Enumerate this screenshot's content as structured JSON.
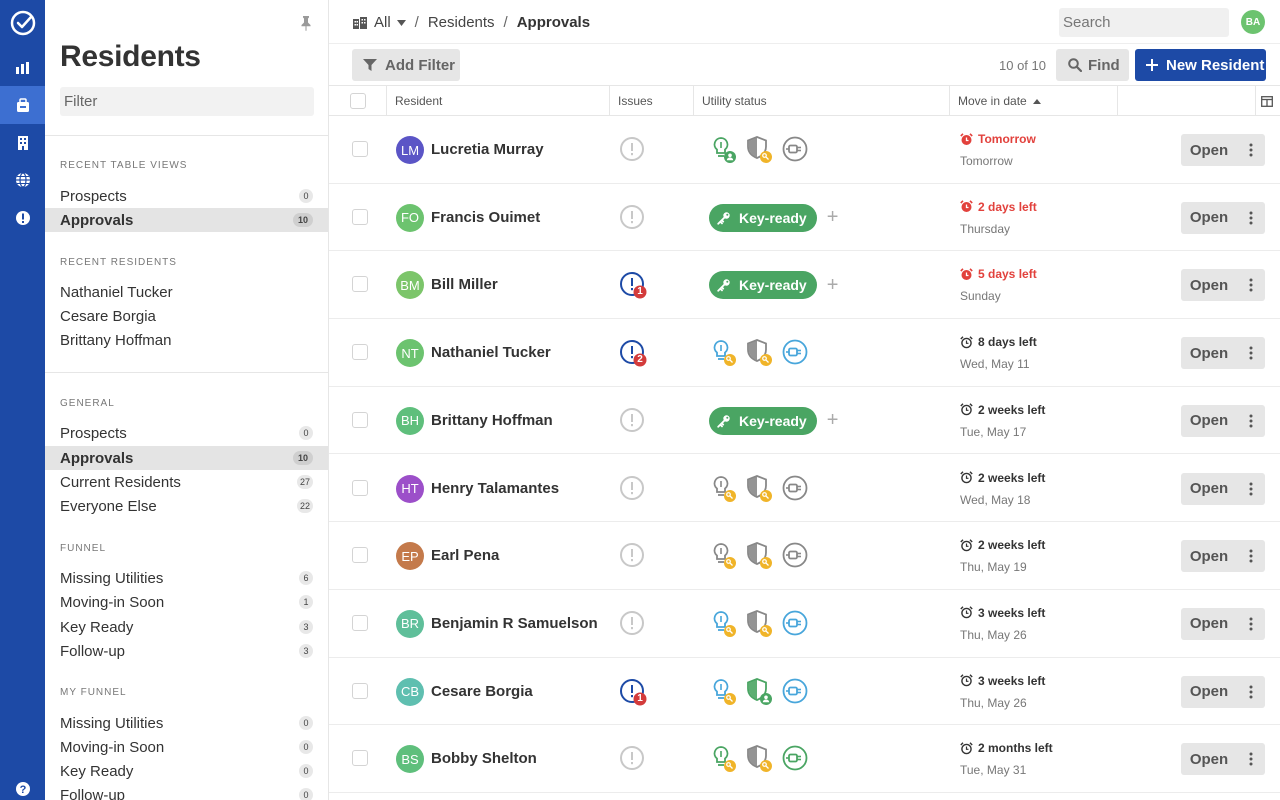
{
  "sidebar": {
    "title": "Residents",
    "filter_placeholder": "Filter",
    "recent_table_views": {
      "heading": "RECENT TABLE VIEWS",
      "items": [
        {
          "label": "Prospects",
          "count": "0"
        },
        {
          "label": "Approvals",
          "count": "10",
          "active": true
        }
      ]
    },
    "recent_residents": {
      "heading": "RECENT RESIDENTS",
      "items": [
        "Nathaniel Tucker",
        "Cesare Borgia",
        "Brittany Hoffman"
      ]
    },
    "general": {
      "heading": "GENERAL",
      "items": [
        {
          "label": "Prospects",
          "count": "0"
        },
        {
          "label": "Approvals",
          "count": "10",
          "active": true
        },
        {
          "label": "Current Residents",
          "count": "27"
        },
        {
          "label": "Everyone Else",
          "count": "22"
        }
      ]
    },
    "funnel": {
      "heading": "FUNNEL",
      "items": [
        {
          "label": "Missing Utilities",
          "count": "6"
        },
        {
          "label": "Moving-in Soon",
          "count": "1"
        },
        {
          "label": "Key Ready",
          "count": "3"
        },
        {
          "label": "Follow-up",
          "count": "3"
        }
      ]
    },
    "my_funnel": {
      "heading": "MY FUNNEL",
      "items": [
        {
          "label": "Missing Utilities",
          "count": "0"
        },
        {
          "label": "Moving-in Soon",
          "count": "0"
        },
        {
          "label": "Key Ready",
          "count": "0"
        },
        {
          "label": "Follow-up",
          "count": "0"
        }
      ]
    }
  },
  "breadcrumb": {
    "all": "All",
    "residents": "Residents",
    "current": "Approvals",
    "sep": "/"
  },
  "search": {
    "placeholder": "Search"
  },
  "user": {
    "initials": "BA",
    "color": "#6cc36f"
  },
  "toolbar": {
    "add_filter": "Add Filter",
    "count_label": "10 of 10",
    "find": "Find",
    "new_resident": "New Resident"
  },
  "table": {
    "columns": {
      "resident": "Resident",
      "issues": "Issues",
      "utility_status": "Utility status",
      "move_in_date": "Move in date"
    },
    "open_label": "Open",
    "key_ready_label": "Key-ready",
    "rows": [
      {
        "initials": "LM",
        "name": "Lucretia Murray",
        "avatar_color": "#5b55c6",
        "issues": 0,
        "utility": [
          "power-green-person",
          "shield-gray-key",
          "plug-gray"
        ],
        "urgent": true,
        "move_primary": "Tomorrow",
        "move_secondary": "Tomorrow"
      },
      {
        "initials": "FO",
        "name": "Francis Ouimet",
        "avatar_color": "#6cc36f",
        "issues": 0,
        "utility": "key-ready",
        "urgent": true,
        "move_primary": "2 days left",
        "move_secondary": "Thursday"
      },
      {
        "initials": "BM",
        "name": "Bill Miller",
        "avatar_color": "#7cc56a",
        "issues": 1,
        "utility": "key-ready",
        "urgent": true,
        "move_primary": "5 days left",
        "move_secondary": "Sunday"
      },
      {
        "initials": "NT",
        "name": "Nathaniel Tucker",
        "avatar_color": "#6cc36f",
        "issues": 2,
        "utility": [
          "power-blue-key",
          "shield-gray-key",
          "plug-blue"
        ],
        "urgent": false,
        "move_primary": "8 days left",
        "move_secondary": "Wed, May 11"
      },
      {
        "initials": "BH",
        "name": "Brittany Hoffman",
        "avatar_color": "#5fbf7c",
        "issues": 0,
        "utility": "key-ready",
        "urgent": false,
        "move_primary": "2 weeks left",
        "move_secondary": "Tue, May 17"
      },
      {
        "initials": "HT",
        "name": "Henry Talamantes",
        "avatar_color": "#9c4fc9",
        "issues": 0,
        "utility": [
          "power-gray-key",
          "shield-gray-key",
          "plug-gray"
        ],
        "urgent": false,
        "move_primary": "2 weeks left",
        "move_secondary": "Wed, May 18"
      },
      {
        "initials": "EP",
        "name": "Earl Pena",
        "avatar_color": "#c47a4b",
        "issues": 0,
        "utility": [
          "power-gray-key",
          "shield-gray-key",
          "plug-gray"
        ],
        "urgent": false,
        "move_primary": "2 weeks left",
        "move_secondary": "Thu, May 19"
      },
      {
        "initials": "BR",
        "name": "Benjamin R Samuelson",
        "avatar_color": "#5fbf9a",
        "issues": 0,
        "utility": [
          "power-blue-key",
          "shield-gray-key",
          "plug-blue"
        ],
        "urgent": false,
        "move_primary": "3 weeks left",
        "move_secondary": "Thu, May 26"
      },
      {
        "initials": "CB",
        "name": "Cesare Borgia",
        "avatar_color": "#5fbfb0",
        "issues": 1,
        "utility": [
          "power-blue-key",
          "shield-green-person",
          "plug-blue"
        ],
        "urgent": false,
        "move_primary": "3 weeks left",
        "move_secondary": "Thu, May 26"
      },
      {
        "initials": "BS",
        "name": "Bobby Shelton",
        "avatar_color": "#5fbf7c",
        "issues": 0,
        "utility": [
          "power-green-key",
          "shield-gray-key",
          "plug-green"
        ],
        "urgent": false,
        "move_primary": "2 months left",
        "move_secondary": "Tue, May 31"
      }
    ]
  },
  "colors": {
    "brand": "#1d4aa6",
    "brand_active": "#3d6fd1",
    "urgent": "#e2413c",
    "key_ready": "#4aa563",
    "util_green": "#4aa563",
    "util_blue": "#48a6db",
    "util_gray": "#888888",
    "badge_key": "#f0b429",
    "issue_red": "#d33b3b",
    "issue_blue": "#1d4aa6"
  }
}
